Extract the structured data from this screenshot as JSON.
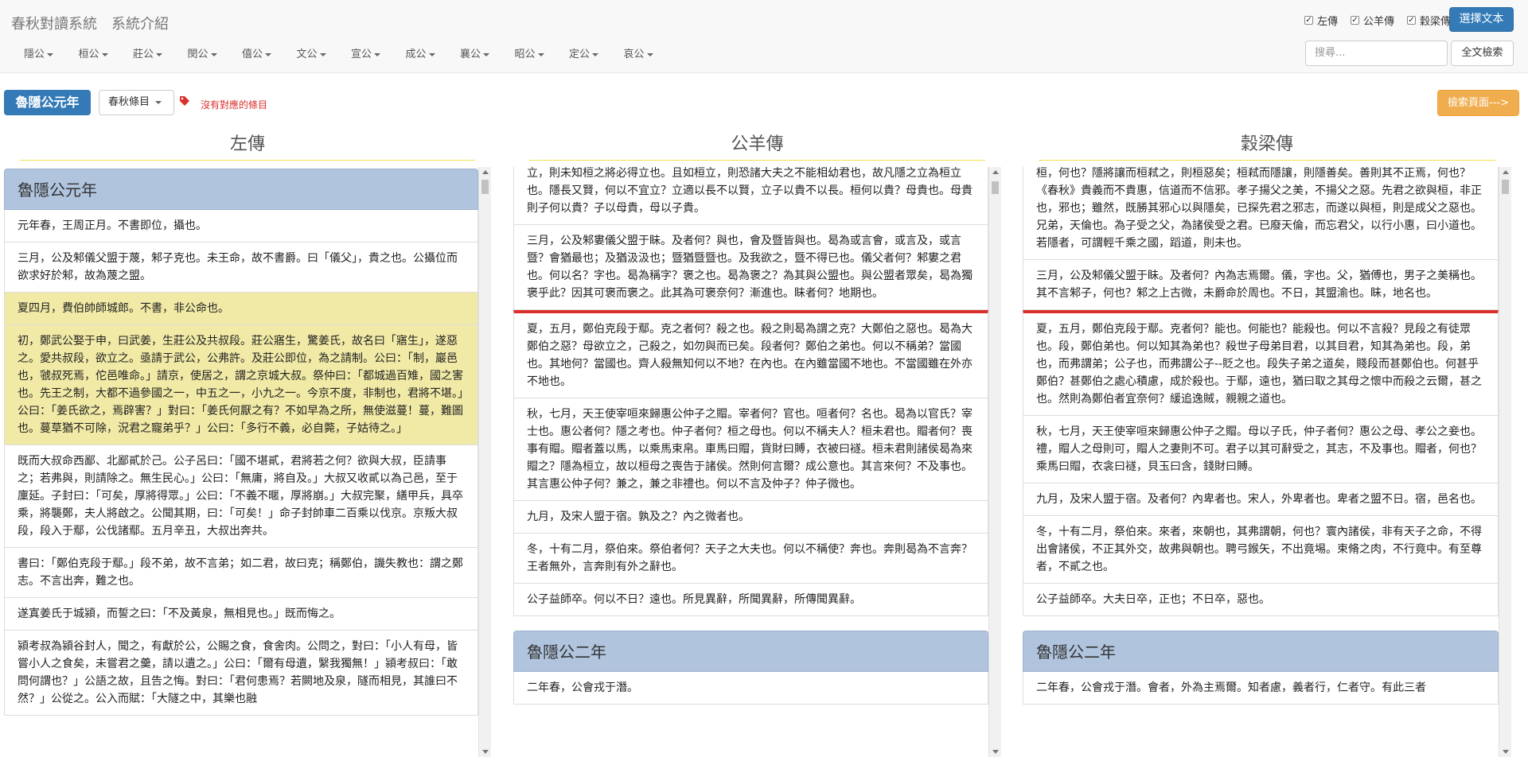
{
  "brand": {
    "system": "春秋對讀系統",
    "intro": "系統介紹"
  },
  "menu": [
    "隱公",
    "桓公",
    "莊公",
    "閔公",
    "僖公",
    "文公",
    "宣公",
    "成公",
    "襄公",
    "昭公",
    "定公",
    "哀公"
  ],
  "checks": [
    {
      "label": "左傳",
      "checked": true
    },
    {
      "label": "公羊傳",
      "checked": true
    },
    {
      "label": "穀梁傳",
      "checked": true
    }
  ],
  "select_text_button": "選擇文本",
  "search_placeholder": "搜尋...",
  "fulltext_button": "全文檢索",
  "toolbar": {
    "title": "魯隱公元年",
    "dropdown": "春秋條目",
    "notice": "沒有對應的條目",
    "back_button": "檢索頁面--->"
  },
  "columns": {
    "zuo": {
      "heading": "左傳",
      "panel_title": "魯隱公元年",
      "items": [
        "元年春，王周正月。不書即位，攝也。",
        "三月，公及邾儀父盟于蔑，邾子克也。未王命，故不書爵。曰「儀父」，貴之也。公攝位而欲求好於邾，故為蔑之盟。",
        "夏四月，費伯帥師城郎。不書，非公命也。",
        "初，鄭武公娶于申，曰武姜，生莊公及共叔段。莊公寤生，驚姜氏，故名曰「寤生」，遂惡之。愛共叔段，欲立之。亟請于武公，公弗許。及莊公即位，為之請制。公曰：「制，巖邑也，虢叔死焉，佗邑唯命。」請京，使居之，謂之京城大叔。祭仲曰：「都城過百雉，國之害也。先王之制，大都不過參國之一，中五之一，小九之一。今京不度，非制也，君將不堪。」公曰：「姜氏欲之，焉辟害？」對曰：「姜氏何厭之有？不如早為之所，無使滋蔓！蔓，難圖也。蔓草猶不可除，況君之寵弟乎？」公曰：「多行不義，必自斃，子姑待之。」",
        "既而大叔命西鄙、北鄙貳於己。公子呂曰：「國不堪貳，君將若之何？欲與大叔，臣請事之；若弗與，則請除之。無生民心。」公曰：「無庸，將自及。」大叔又收貳以為己邑，至于廩延。子封曰：「可矣，厚將得眾。」公曰：「不義不暱，厚將崩。」大叔完聚，繕甲兵，具卒乘，將襲鄭，夫人將啟之。公聞其期，曰：「可矣！」命子封帥車二百乘以伐京。京叛大叔段，段入于鄢，公伐諸鄢。五月辛丑，大叔出奔共。",
        "書曰：「鄭伯克段于鄢。」段不弟，故不言弟；如二君，故曰克；稱鄭伯，譏失教也：謂之鄭志。不言出奔，難之也。",
        "遂寘姜氏于城潁，而誓之曰：「不及黃泉，無相見也。」既而悔之。",
        "潁考叔為潁谷封人，聞之，有獻於公，公賜之食，食舍肉。公問之，對曰：「小人有母，皆嘗小人之食矣，未嘗君之羹，請以遺之。」公曰：「爾有母遺，繄我獨無！」潁考叔曰：「敢問何謂也？」公語之故，且告之悔。對曰：「君何患焉？若闕地及泉，隧而相見，其誰曰不然？」公從之。公入而賦：「大隧之中，其樂也融"
      ]
    },
    "gongyang": {
      "heading": "公羊傳",
      "top_items": [
        "立，則未知桓之將必得立也。且如桓立，則恐諸大夫之不能相幼君也，故凡隱之立為桓立也。隱長又賢，何以不宜立？立適以長不以賢，立子以貴不以長。桓何以貴？母貴也。母貴則子何以貴？子以母貴，母以子貴。",
        "三月，公及邾婁儀父盟于眛。及者何？與也，會及暨皆與也。曷為或言會，或言及，或言暨？會猶最也；及猶汲汲也；暨猶暨暨也。及我欲之，暨不得已也。儀父者何？邾婁之君也。何以名？字也。曷為稱字？褒之也。曷為褒之？為其與公盟也。與公盟者眾矣，曷為獨褒乎此？因其可褒而褒之。此其為可褒奈何？漸進也。眛者何？地期也。",
        "夏，五月，鄭伯克段于鄢。克之者何？殺之也。殺之則曷為謂之克？大鄭伯之惡也。曷為大鄭伯之惡？母欲立之，己殺之，如勿與而已矣。段者何？鄭伯之弟也。何以不稱弟？當國也。其地何？當國也。齊人殺無知何以不地？在內也。在內雖當國不地也。不當國雖在外亦不地也。",
        "秋，七月，天王使宰咺來歸惠公仲子之賵。宰者何？官也。咺者何？名也。曷為以官氏？宰士也。惠公者何？隱之考也。仲子者何？桓之母也。何以不稱夫人？桓未君也。賵者何？喪事有賵。賵者蓋以馬，以乘馬束帛。車馬曰賵，貨財曰賻，衣被曰襚。桓未君則諸侯曷為來賵之？隱為桓立，故以桓母之喪告于諸侯。然則何言爾？成公意也。其言來何？不及事也。其言惠公仲子何？兼之，兼之非禮也。何以不言及仲子？仲子微也。",
        "九月，及宋人盟于宿。孰及之？內之微者也。",
        "冬，十有二月，祭伯來。祭伯者何？天子之大夫也。何以不稱使？奔也。奔則曷為不言奔？王者無外，言奔則有外之辭也。",
        "公子益師卒。何以不日？遠也。所見異辭，所聞異辭，所傳聞異辭。"
      ],
      "panel_title": "魯隱公二年",
      "panel_items": [
        "二年春，公會戎于潛。"
      ]
    },
    "guliang": {
      "heading": "穀梁傳",
      "top_items": [
        "桓，何也？隱將讓而桓弒之，則桓惡矣；桓弒而隱讓，則隱善矣。善則其不正焉，何也？《春秋》貴義而不貴惠，信道而不信邪。孝子揚父之美，不揚父之惡。先君之欲與桓，非正也，邪也；雖然，既勝其邪心以與隱矣，已探先君之邪志，而遂以與桓，則是成父之惡也。兄弟，天倫也。為子受之父，為諸侯受之君。已廢天倫，而忘君父，以行小惠，曰小道也。若隱者，可謂輕千乘之國，蹈道，則未也。",
        "三月，公及邾儀父盟于眛。及者何？內為志焉爾。儀，字也。父，猶傅也，男子之美稱也。其不言邾子，何也？邾之上古微，未爵命於周也。不日，其盟渝也。眛，地名也。",
        "夏，五月，鄭伯克段于鄢。克者何？能也。何能也？能殺也。何以不言殺？見段之有徒眾也。段，鄭伯弟也。何以知其為弟也？殺世子母弟目君，以其目君，知其為弟也。段，弟也，而弗謂弟；公子也，而弗謂公子--貶之也。段失子弟之道矣，賤段而甚鄭伯也。何甚乎鄭伯？甚鄭伯之處心積慮，成於殺也。于鄢，遠也，猶曰取之其母之懷中而殺之云爾，甚之也。然則為鄭伯者宜奈何？緩追逸賊，親親之道也。",
        "秋，七月，天王使宰咺來歸惠公仲子之賵。母以子氏，仲子者何？惠公之母、孝公之妾也。禮，賵人之母則可，賵人之妻則不可。君子以其可辭受之，其志，不及事也。賵者，何也？乘馬曰賵，衣衾曰襚，貝玉曰含，錢財曰賻。",
        "九月，及宋人盟于宿。及者何？內卑者也。宋人，外卑者也。卑者之盟不日。宿，邑名也。",
        "冬，十有二月，祭伯來。來者，來朝也，其弗謂朝，何也？寰內諸侯，非有天子之命，不得出會諸侯，不正其外交，故弗與朝也。聘弓鍭矢，不出竟埸。束脩之肉，不行竟中。有至尊者，不貳之也。",
        "公子益師卒。大夫日卒，正也；不日卒，惡也。"
      ],
      "panel_title": "魯隱公二年",
      "panel_items": [
        "二年春，公會戎于潛。會者，外為主焉爾。知者慮，義者行，仁者守。有此三者"
      ]
    }
  }
}
